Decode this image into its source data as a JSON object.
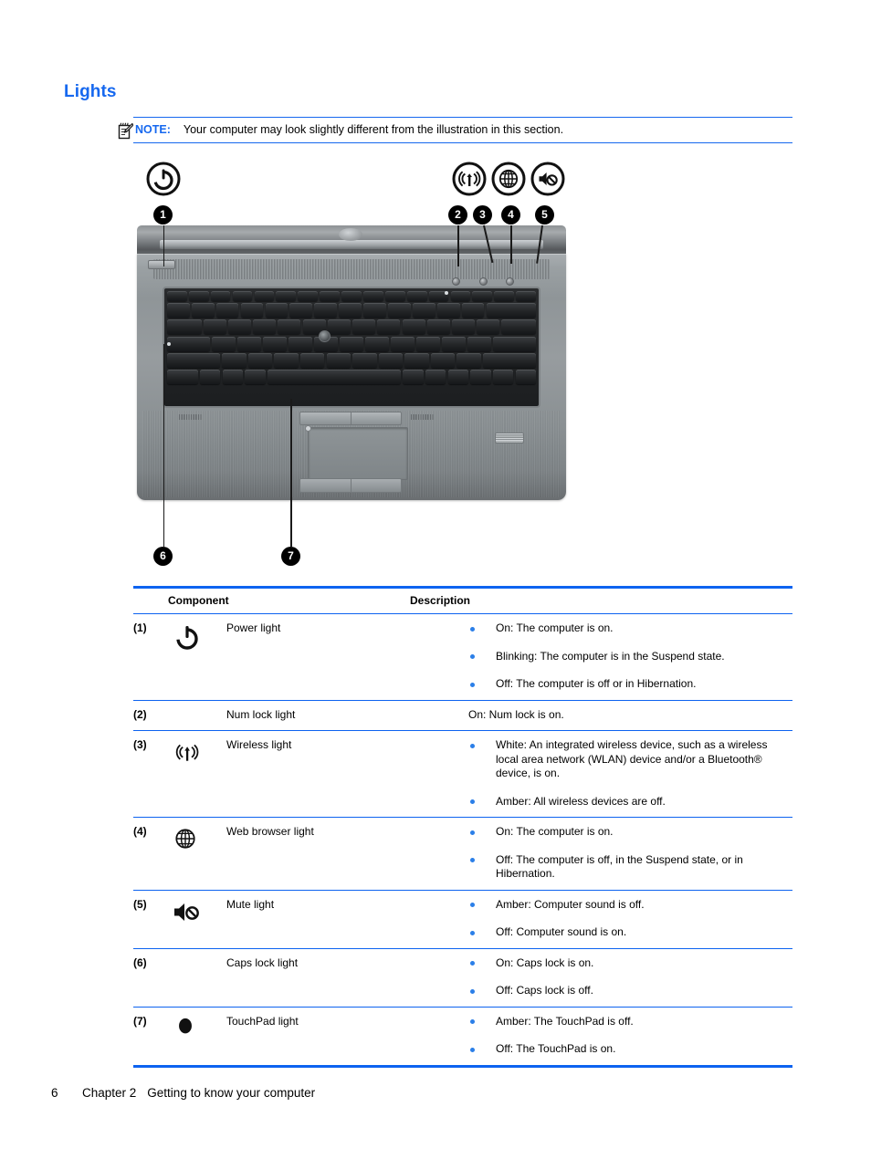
{
  "heading": "Lights",
  "note": {
    "icon": "note-pencil-icon",
    "label": "NOTE:",
    "text": "Your computer may look slightly different from the illustration in this section."
  },
  "figure": {
    "alt": "HP EliteBook notebook computer top view with light callouts",
    "icons": [
      {
        "name": "power-icon",
        "callout": "1"
      },
      {
        "name": "wireless-icon",
        "callout": "3"
      },
      {
        "name": "web-browser-globe-icon",
        "callout": "4"
      },
      {
        "name": "mute-icon",
        "callout": "5"
      }
    ],
    "callouts": [
      "1",
      "2",
      "3",
      "4",
      "5",
      "6",
      "7"
    ]
  },
  "table": {
    "headers": {
      "component": "Component",
      "description": "Description"
    },
    "rows": [
      {
        "num": "(1)",
        "icon": "power-icon",
        "name": "Power light",
        "bullets": [
          "On: The computer is on.",
          "Blinking: The computer is in the Suspend state.",
          "Off: The computer is off or in Hibernation."
        ]
      },
      {
        "num": "(2)",
        "icon": "",
        "name": "Num lock light",
        "plain": "On: Num lock is on."
      },
      {
        "num": "(3)",
        "icon": "wireless-icon",
        "name": "Wireless light",
        "bullets": [
          "White: An integrated wireless device, such as a wireless local area network (WLAN) device and/or a Bluetooth® device, is on.",
          "Amber: All wireless devices are off."
        ]
      },
      {
        "num": "(4)",
        "icon": "web-browser-globe-icon",
        "name": "Web browser light",
        "bullets": [
          "On: The computer is on.",
          "Off: The computer is off, in the Suspend state, or in Hibernation."
        ]
      },
      {
        "num": "(5)",
        "icon": "mute-icon",
        "name": "Mute light",
        "bullets": [
          "Amber: Computer sound is off.",
          "Off: Computer sound is on."
        ]
      },
      {
        "num": "(6)",
        "icon": "",
        "name": "Caps lock light",
        "bullets": [
          "On: Caps lock is on.",
          "Off: Caps lock is off."
        ]
      },
      {
        "num": "(7)",
        "icon": "touchpad-light-dot-icon",
        "name": "TouchPad light",
        "bullets": [
          "Amber: The TouchPad is off.",
          "Off: The TouchPad is on."
        ]
      }
    ]
  },
  "footer": {
    "page_number": "6",
    "chapter": "Chapter 2",
    "chapter_title": "Getting to know your computer"
  },
  "colors": {
    "accent_blue": "#1668ef",
    "rule_blue": "#0d63f0",
    "bullet_blue": "#2b7fe8"
  }
}
